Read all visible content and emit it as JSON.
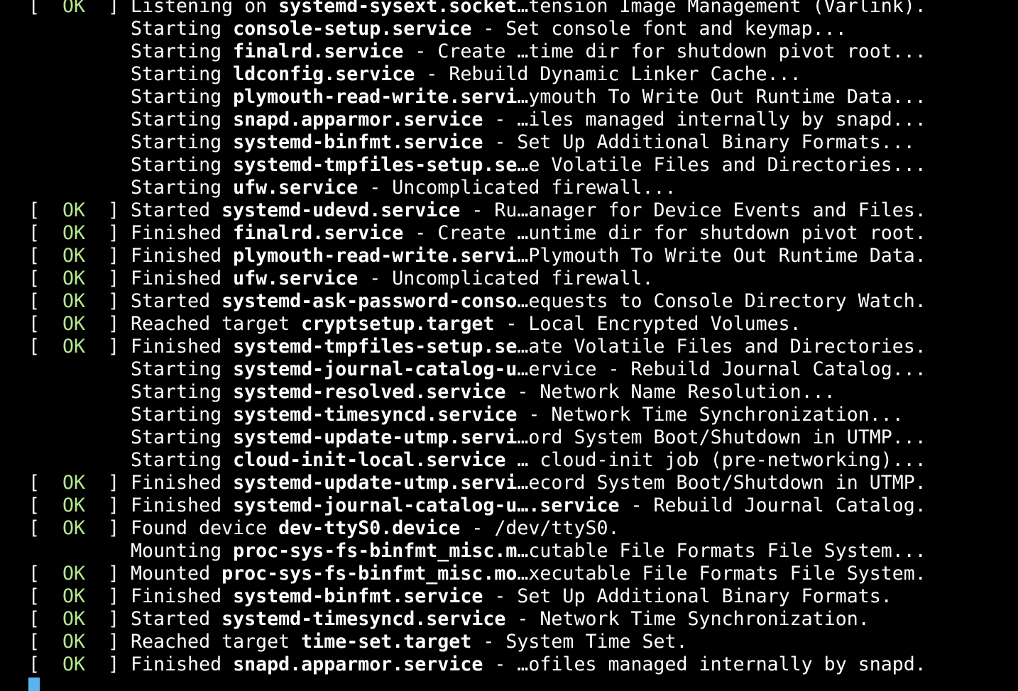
{
  "terminal": {
    "colors": {
      "background": "#000000",
      "foreground": "#ffffff",
      "ok": "#b5e88f",
      "cursor": "#5ab4f0"
    },
    "lines": [
      {
        "status": "OK",
        "pre": "Listening on ",
        "unit": "systemd-sysext.socket",
        "post": "…tension Image Management (Varlink)."
      },
      {
        "status": "",
        "pre": "Starting ",
        "unit": "console-setup.service",
        "post": " - Set console font and keymap..."
      },
      {
        "status": "",
        "pre": "Starting ",
        "unit": "finalrd.service",
        "post": " - Create …time dir for shutdown pivot root..."
      },
      {
        "status": "",
        "pre": "Starting ",
        "unit": "ldconfig.service",
        "post": " - Rebuild Dynamic Linker Cache..."
      },
      {
        "status": "",
        "pre": "Starting ",
        "unit": "plymouth-read-write.servi",
        "post": "…ymouth To Write Out Runtime Data..."
      },
      {
        "status": "",
        "pre": "Starting ",
        "unit": "snapd.apparmor.service",
        "post": " - …iles managed internally by snapd..."
      },
      {
        "status": "",
        "pre": "Starting ",
        "unit": "systemd-binfmt.service",
        "post": " - Set Up Additional Binary Formats..."
      },
      {
        "status": "",
        "pre": "Starting ",
        "unit": "systemd-tmpfiles-setup.se",
        "post": "…e Volatile Files and Directories..."
      },
      {
        "status": "",
        "pre": "Starting ",
        "unit": "ufw.service",
        "post": " - Uncomplicated firewall..."
      },
      {
        "status": "OK",
        "pre": "Started ",
        "unit": "systemd-udevd.service",
        "post": " - Ru…anager for Device Events and Files."
      },
      {
        "status": "OK",
        "pre": "Finished ",
        "unit": "finalrd.service",
        "post": " - Create …untime dir for shutdown pivot root."
      },
      {
        "status": "OK",
        "pre": "Finished ",
        "unit": "plymouth-read-write.servi",
        "post": "…Plymouth To Write Out Runtime Data."
      },
      {
        "status": "OK",
        "pre": "Finished ",
        "unit": "ufw.service",
        "post": " - Uncomplicated firewall."
      },
      {
        "status": "OK",
        "pre": "Started ",
        "unit": "systemd-ask-password-conso",
        "post": "…equests to Console Directory Watch."
      },
      {
        "status": "OK",
        "pre": "Reached target ",
        "unit": "cryptsetup.target",
        "post": " - Local Encrypted Volumes."
      },
      {
        "status": "OK",
        "pre": "Finished ",
        "unit": "systemd-tmpfiles-setup.se",
        "post": "…ate Volatile Files and Directories."
      },
      {
        "status": "",
        "pre": "Starting ",
        "unit": "systemd-journal-catalog-u",
        "post": "…ervice - Rebuild Journal Catalog..."
      },
      {
        "status": "",
        "pre": "Starting ",
        "unit": "systemd-resolved.service",
        "post": " - Network Name Resolution..."
      },
      {
        "status": "",
        "pre": "Starting ",
        "unit": "systemd-timesyncd.service",
        "post": " - Network Time Synchronization..."
      },
      {
        "status": "",
        "pre": "Starting ",
        "unit": "systemd-update-utmp.servi",
        "post": "…ord System Boot/Shutdown in UTMP..."
      },
      {
        "status": "",
        "pre": "Starting ",
        "unit": "cloud-init-local.service",
        "post": " … cloud-init job (pre-networking)..."
      },
      {
        "status": "OK",
        "pre": "Finished ",
        "unit": "systemd-update-utmp.servi",
        "post": "…ecord System Boot/Shutdown in UTMP."
      },
      {
        "status": "OK",
        "pre": "Finished ",
        "unit": "systemd-journal-catalog-u….service",
        "post": " - Rebuild Journal Catalog."
      },
      {
        "status": "OK",
        "pre": "Found device ",
        "unit": "dev-ttyS0.device",
        "post": " - /dev/ttyS0."
      },
      {
        "status": "",
        "pre": "Mounting ",
        "unit": "proc-sys-fs-binfmt_misc.m",
        "post": "…cutable File Formats File System..."
      },
      {
        "status": "OK",
        "pre": "Mounted ",
        "unit": "proc-sys-fs-binfmt_misc.mo",
        "post": "…xecutable File Formats File System."
      },
      {
        "status": "OK",
        "pre": "Finished ",
        "unit": "systemd-binfmt.service",
        "post": " - Set Up Additional Binary Formats."
      },
      {
        "status": "OK",
        "pre": "Started ",
        "unit": "systemd-timesyncd.service",
        "post": " - Network Time Synchronization."
      },
      {
        "status": "OK",
        "pre": "Reached target ",
        "unit": "time-set.target",
        "post": " - System Time Set."
      },
      {
        "status": "OK",
        "pre": "Finished ",
        "unit": "snapd.apparmor.service",
        "post": " - …ofiles managed internally by snapd."
      }
    ]
  }
}
